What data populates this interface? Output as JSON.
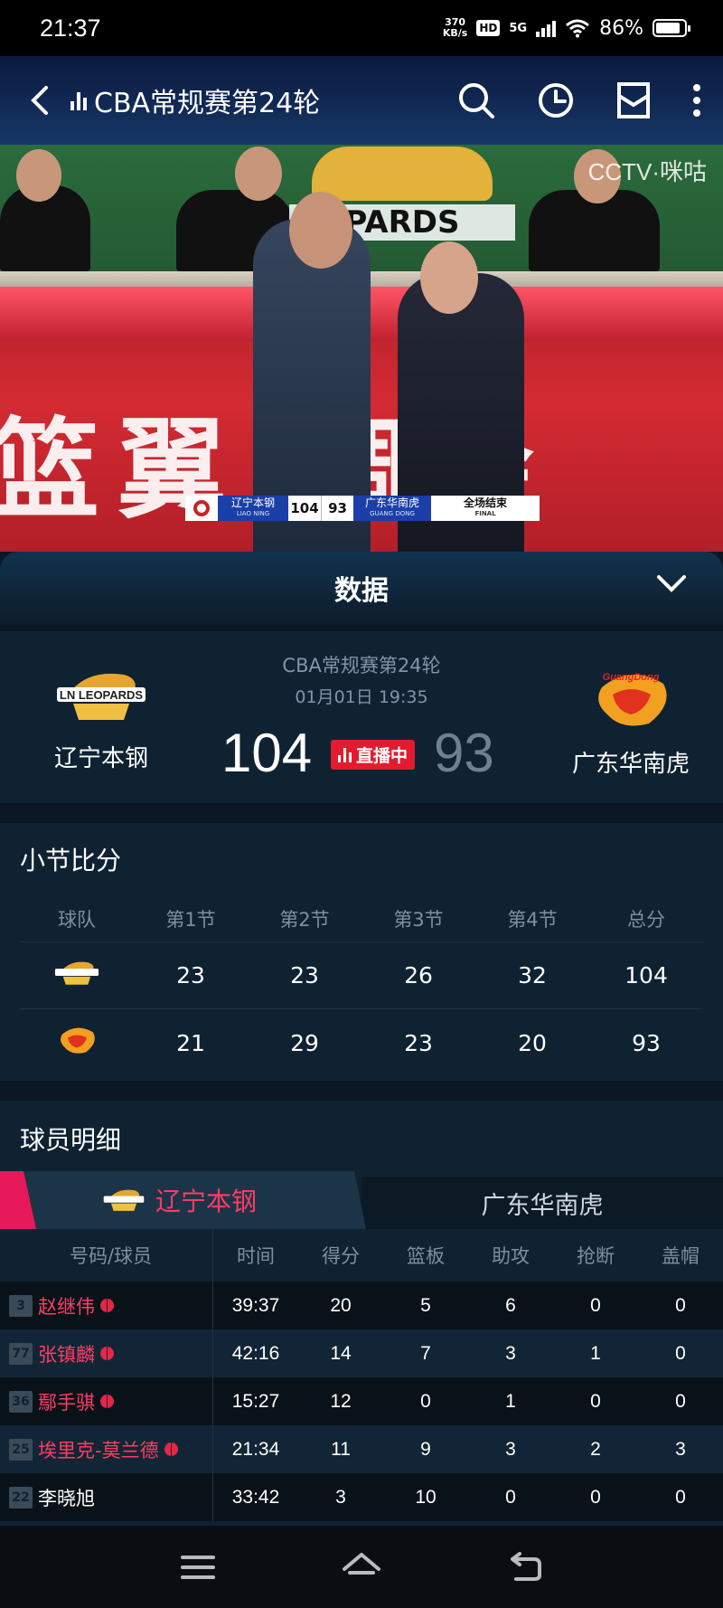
{
  "status_bar": {
    "time": "21:37",
    "net_speed_value": "370",
    "net_speed_unit": "KB/s",
    "hd": "HD",
    "network": "5G",
    "battery": "86%"
  },
  "video": {
    "title": "CBA常规赛第24轮",
    "wall_logo_text": "PARDS",
    "broadcaster": "CCTV·咪咕",
    "banner_text": "篮翼   调会",
    "scorebug": {
      "home_name": "辽宁本钢",
      "home_sub": "LIAO NING",
      "home_score": "104",
      "away_score": "93",
      "away_name": "广东华南虎",
      "away_sub": "GUANG DONG",
      "status": "全场结束",
      "status_sub": "FINAL"
    }
  },
  "data_panel": {
    "title": "数据"
  },
  "match": {
    "round": "CBA常规赛第24轮",
    "datetime": "01月01日 19:35",
    "home_team": "辽宁本钢",
    "away_team": "广东华南虎",
    "home_logo_text": "LN LEOPARDS",
    "away_logo_text": "GuangDong",
    "home_score": "104",
    "away_score": "93",
    "live_label": "直播中"
  },
  "quarters": {
    "title": "小节比分",
    "headers": [
      "球队",
      "第1节",
      "第2节",
      "第3节",
      "第4节",
      "总分"
    ],
    "rows": [
      {
        "team": "辽宁本钢",
        "q1": "23",
        "q2": "23",
        "q3": "26",
        "q4": "32",
        "total": "104"
      },
      {
        "team": "广东华南虎",
        "q1": "21",
        "q2": "29",
        "q3": "23",
        "q4": "20",
        "total": "93"
      }
    ]
  },
  "players": {
    "title": "球员明细",
    "tab_active": "辽宁本钢",
    "tab_inactive": "广东华南虎",
    "headers": [
      "号码/球员",
      "时间",
      "得分",
      "篮板",
      "助攻",
      "抢断",
      "盖帽"
    ],
    "rows": [
      {
        "num": "3",
        "name": "赵继伟",
        "starter": true,
        "time": "39:37",
        "pts": "20",
        "reb": "5",
        "ast": "6",
        "stl": "0",
        "blk": "0"
      },
      {
        "num": "77",
        "name": "张镇麟",
        "starter": true,
        "time": "42:16",
        "pts": "14",
        "reb": "7",
        "ast": "3",
        "stl": "1",
        "blk": "0"
      },
      {
        "num": "36",
        "name": "鄢手骐",
        "starter": true,
        "time": "15:27",
        "pts": "12",
        "reb": "0",
        "ast": "1",
        "stl": "0",
        "blk": "0"
      },
      {
        "num": "25",
        "name": "埃里克-莫兰德",
        "starter": true,
        "time": "21:34",
        "pts": "11",
        "reb": "9",
        "ast": "3",
        "stl": "2",
        "blk": "3"
      },
      {
        "num": "22",
        "name": "李晓旭",
        "starter": false,
        "time": "33:42",
        "pts": "3",
        "reb": "10",
        "ast": "0",
        "stl": "0",
        "blk": "0"
      }
    ]
  },
  "colors": {
    "accent": "#e8195a",
    "live_red": "#e21c2e",
    "panel": "#0f2232"
  }
}
